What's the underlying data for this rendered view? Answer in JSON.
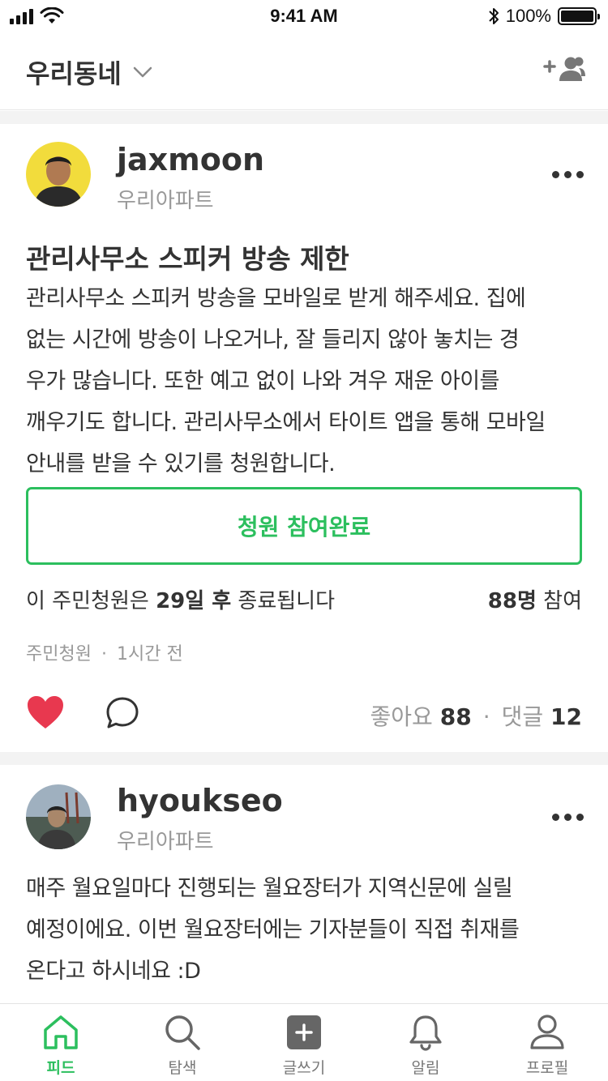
{
  "status_bar": {
    "time": "9:41 AM",
    "battery": "100%"
  },
  "header": {
    "title": "우리동네"
  },
  "posts": [
    {
      "username": "jaxmoon",
      "place": "우리아파트",
      "title": "관리사무소 스피커 방송 제한",
      "body_lines": [
        "관리사무소 스피커 방송을 모바일로 받게 해주세요. 집에",
        "없는 시간에 방송이 나오거나, 잘 들리지 않아 놓치는 경",
        "우가 많습니다. 또한 예고 없이 나와 겨우 재운 아이를",
        "깨우기도 합니다. 관리사무소에서 타이트 앱을 통해 모바일",
        "안내를 받을 수 있기를 청원합니다."
      ],
      "petition_button": "청원 참여완료",
      "petition_info": {
        "prefix": "이 주민청원은 ",
        "days": "29일 후",
        "suffix": " 종료됩니다",
        "count": "88명",
        "count_suffix": " 참여"
      },
      "category": "주민청원",
      "time_ago": "1시간 전",
      "likes_label": "좋아요",
      "likes": "88",
      "comments_label": "댓글",
      "comments": "12"
    },
    {
      "username": "hyoukseo",
      "place": "우리아파트",
      "body_lines": [
        "매주 월요일마다 진행되는 월요장터가 지역신문에 실릴",
        "예정이에요. 이번 월요장터에는 기자분들이 직접 취재를",
        "온다고 하시네요 :D"
      ]
    }
  ],
  "tabs": [
    {
      "label": "피드",
      "icon": "home-icon",
      "active": true
    },
    {
      "label": "탐색",
      "icon": "search-icon",
      "active": false
    },
    {
      "label": "글쓰기",
      "icon": "write-plus-icon",
      "active": false
    },
    {
      "label": "알림",
      "icon": "bell-icon",
      "active": false
    },
    {
      "label": "프로필",
      "icon": "profile-icon",
      "active": false
    }
  ],
  "colors": {
    "accent": "#2cbf5e",
    "like": "#e8384f"
  }
}
